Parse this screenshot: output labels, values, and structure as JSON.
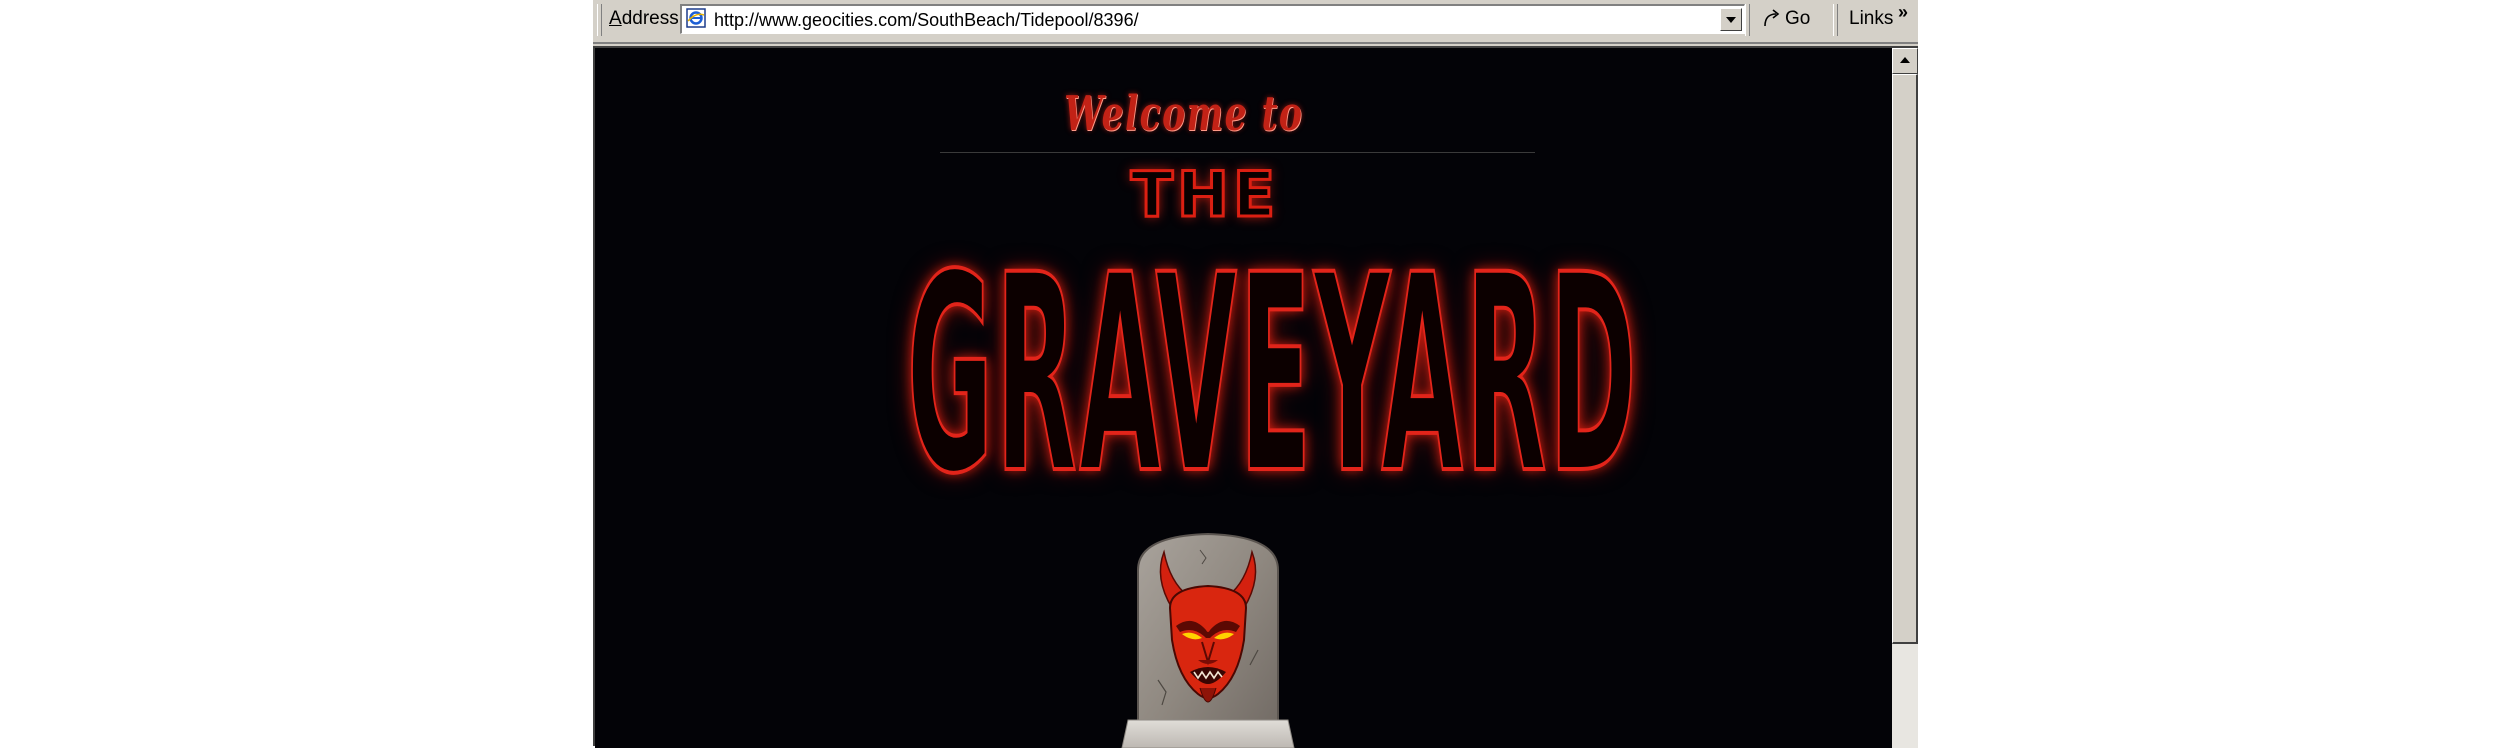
{
  "address_bar": {
    "label": "Address",
    "url": "http://www.geocities.com/SouthBeach/Tidepool/8396/",
    "go_label": "Go",
    "links_label": "Links",
    "chevron": "»",
    "page_icon": "ie-page-icon",
    "go_icon": "go-arrow-icon"
  },
  "page": {
    "welcome_text": "Welcome to",
    "the_text": "THE",
    "title_text": "GRAVEYARD",
    "background_color": "#030307",
    "title_color": "#e2241a",
    "image": "devil-tombstone-icon"
  }
}
